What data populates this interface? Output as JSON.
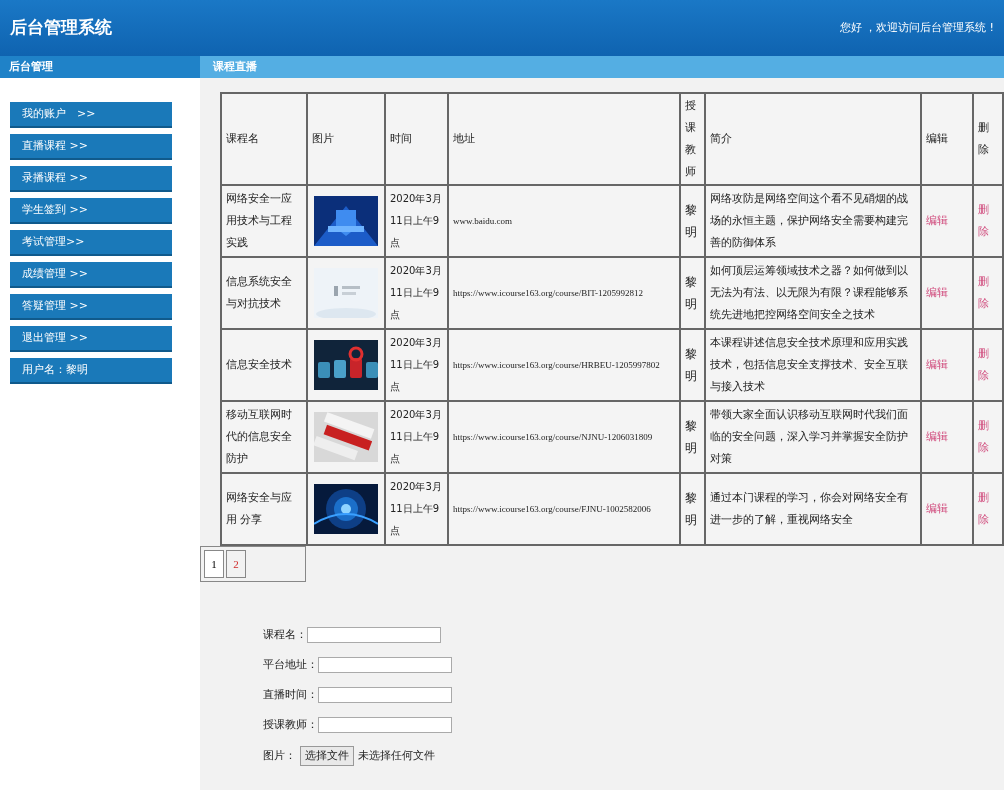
{
  "header": {
    "title": "后台管理系统",
    "greeting": "您好 ，欢迎访问后台管理系统 !"
  },
  "sidebar": {
    "title": "后台管理",
    "items": [
      {
        "label": "我的账户　>>"
      },
      {
        "label": "直播课程 >>"
      },
      {
        "label": "录播课程 >>"
      },
      {
        "label": "学生签到 >>"
      },
      {
        "label": "考试管理>>"
      },
      {
        "label": "成绩管理 >>"
      },
      {
        "label": "答疑管理 >>"
      },
      {
        "label": "退出管理 >>"
      },
      {
        "label": "用户名：黎明"
      }
    ]
  },
  "section_title": "课程直播",
  "table": {
    "columns": [
      "课程名",
      "图片",
      "时间",
      "地址",
      "授课教师",
      "简介",
      "编辑",
      "删除"
    ],
    "rows": [
      {
        "name": "网络安全一应用技术与工程实践",
        "time": "2020年3月11日上午9点",
        "address": "www.baidu.com",
        "teacher": "黎明",
        "intro": "网络攻防是网络空间这个看不见硝烟的战场的永恒主题，保护网络安全需要构建完善的防御体系",
        "edit": "编辑",
        "delete": "删除"
      },
      {
        "name": "信息系统安全与对抗技术",
        "time": "2020年3月11日上午9点",
        "address": "https://www.icourse163.org/course/BIT-1205992812",
        "teacher": "黎明",
        "intro": "如何顶层运筹领域技术之器？如何做到以无法为有法、以无限为有限？课程能够系统先进地把控网络空间安全之技术",
        "edit": "编辑",
        "delete": "删除"
      },
      {
        "name": "信息安全技术",
        "time": "2020年3月11日上午9点",
        "address": "https://www.icourse163.org/course/HRBEU-1205997802",
        "teacher": "黎明",
        "intro": "本课程讲述信息安全技术原理和应用实践技术，包括信息安全支撑技术、安全互联与接入技术",
        "edit": "编辑",
        "delete": "删除"
      },
      {
        "name": "移动互联网时代的信息安全防护",
        "time": "2020年3月11日上午9点",
        "address": "https://www.icourse163.org/course/NJNU-1206031809",
        "teacher": "黎明",
        "intro": "带领大家全面认识移动互联网时代我们面临的安全问题，深入学习并掌握安全防护对策",
        "edit": "编辑",
        "delete": "删除"
      },
      {
        "name": "网络安全与应用 分享",
        "time": "2020年3月11日上午9点",
        "address": "https://www.icourse163.org/course/FJNU-1002582006",
        "teacher": "黎明",
        "intro": "通过本门课程的学习，你会对网络安全有进一步的了解，重视网络安全",
        "edit": "编辑",
        "delete": "删除"
      }
    ]
  },
  "pagination": [
    {
      "label": "1",
      "selected": true
    },
    {
      "label": "2",
      "selected": false
    }
  ],
  "form": {
    "fields": [
      {
        "label": "课程名："
      },
      {
        "label": "平台地址："
      },
      {
        "label": "直播时间："
      },
      {
        "label": "授课教师："
      }
    ],
    "file": {
      "label": "图片：",
      "button": "选择文件",
      "status": "未选择任何文件"
    }
  }
}
